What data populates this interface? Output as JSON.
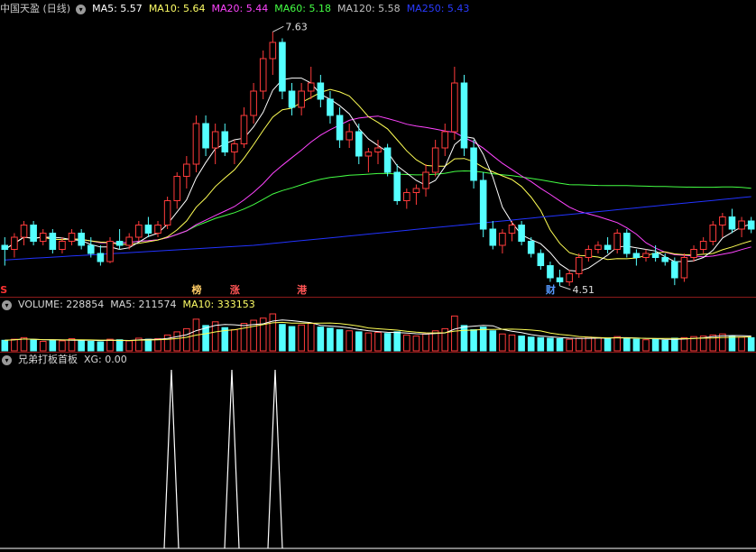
{
  "main": {
    "title": "中国天盈 (日线)",
    "ma_labels": [
      {
        "text": "MA5: 5.57",
        "color": "#ffffff"
      },
      {
        "text": "MA10: 5.64",
        "color": "#ffff66"
      },
      {
        "text": "MA20: 5.44",
        "color": "#ff44ff"
      },
      {
        "text": "MA60: 5.18",
        "color": "#44ff44"
      },
      {
        "text": "MA120: 5.58",
        "color": "#c0c0c0"
      },
      {
        "text": "MA250: 5.43",
        "color": "#2a3bff"
      }
    ],
    "high_label": "7.63",
    "low_label": "4.51",
    "markers": [
      {
        "text": "S",
        "color": "#ff3333"
      },
      {
        "text": "榜",
        "color": "#ffcc66"
      },
      {
        "text": "涨",
        "color": "#ff5555"
      },
      {
        "text": "港",
        "color": "#ff5555"
      },
      {
        "text": "财",
        "color": "#5599ff"
      }
    ]
  },
  "volume": {
    "labels": [
      {
        "text": "VOLUME: 228854",
        "color": "#d8d8d8"
      },
      {
        "text": "MA5: 211574",
        "color": "#d8d8d8"
      },
      {
        "text": "MA10: 333153",
        "color": "#ffff66"
      }
    ]
  },
  "indicator": {
    "labels": [
      {
        "text": "兄弟打板首板",
        "color": "#d8d8d8"
      },
      {
        "text": "XG: 0.00",
        "color": "#d8d8d8"
      }
    ],
    "signals": [
      0.7,
      2.2,
      4.8
    ]
  },
  "colors": {
    "up": "#ff3b3b",
    "down": "#54ffff",
    "ma5": "#ffffff",
    "ma10": "#ffff55",
    "ma20": "#ff44ff",
    "ma60": "#44ff44",
    "ma250": "#2233ff"
  },
  "chart_data": {
    "type": "candlestick",
    "candles": [
      [
        5.0,
        5.1,
        4.75,
        4.95
      ],
      [
        4.95,
        5.15,
        4.85,
        5.1
      ],
      [
        5.1,
        5.3,
        5.0,
        5.25
      ],
      [
        5.25,
        5.3,
        5.0,
        5.05
      ],
      [
        5.05,
        5.2,
        5.0,
        5.15
      ],
      [
        5.15,
        5.2,
        4.9,
        4.95
      ],
      [
        4.95,
        5.1,
        4.9,
        5.05
      ],
      [
        5.05,
        5.2,
        5.0,
        5.15
      ],
      [
        5.15,
        5.2,
        4.95,
        5.0
      ],
      [
        5.0,
        5.1,
        4.85,
        4.9
      ],
      [
        4.9,
        5.0,
        4.75,
        4.8
      ],
      [
        4.8,
        5.1,
        4.78,
        5.05
      ],
      [
        5.05,
        5.2,
        4.95,
        5.0
      ],
      [
        5.0,
        5.15,
        4.95,
        5.1
      ],
      [
        5.1,
        5.3,
        5.05,
        5.25
      ],
      [
        5.25,
        5.35,
        5.1,
        5.15
      ],
      [
        5.15,
        5.3,
        5.1,
        5.25
      ],
      [
        5.25,
        5.6,
        5.2,
        5.55
      ],
      [
        5.55,
        5.9,
        5.45,
        5.85
      ],
      [
        5.85,
        6.1,
        5.7,
        6.0
      ],
      [
        6.0,
        6.6,
        5.9,
        6.5
      ],
      [
        6.5,
        6.6,
        6.1,
        6.2
      ],
      [
        6.2,
        6.5,
        6.0,
        6.4
      ],
      [
        6.4,
        6.5,
        6.1,
        6.15
      ],
      [
        6.15,
        6.3,
        6.0,
        6.25
      ],
      [
        6.25,
        6.7,
        6.2,
        6.6
      ],
      [
        6.6,
        7.0,
        6.5,
        6.9
      ],
      [
        6.9,
        7.4,
        6.8,
        7.3
      ],
      [
        7.3,
        7.63,
        7.1,
        7.5
      ],
      [
        7.5,
        7.55,
        6.8,
        6.9
      ],
      [
        6.9,
        7.0,
        6.6,
        6.7
      ],
      [
        6.7,
        7.0,
        6.6,
        6.9
      ],
      [
        6.9,
        7.2,
        6.8,
        7.0
      ],
      [
        7.0,
        7.1,
        6.7,
        6.8
      ],
      [
        6.8,
        6.9,
        6.5,
        6.6
      ],
      [
        6.6,
        6.7,
        6.2,
        6.3
      ],
      [
        6.3,
        6.5,
        6.2,
        6.4
      ],
      [
        6.4,
        6.5,
        6.0,
        6.1
      ],
      [
        6.1,
        6.2,
        5.9,
        6.15
      ],
      [
        6.15,
        6.3,
        6.0,
        6.2
      ],
      [
        6.2,
        6.25,
        5.85,
        5.9
      ],
      [
        5.9,
        6.0,
        5.5,
        5.55
      ],
      [
        5.55,
        5.7,
        5.45,
        5.65
      ],
      [
        5.65,
        5.75,
        5.5,
        5.7
      ],
      [
        5.7,
        6.0,
        5.6,
        5.9
      ],
      [
        5.9,
        6.3,
        5.85,
        6.2
      ],
      [
        6.2,
        6.5,
        6.1,
        6.4
      ],
      [
        6.4,
        7.2,
        6.3,
        7.0
      ],
      [
        7.0,
        7.1,
        6.1,
        6.2
      ],
      [
        6.2,
        6.3,
        5.7,
        5.8
      ],
      [
        5.8,
        5.9,
        5.1,
        5.2
      ],
      [
        5.2,
        5.3,
        4.95,
        5.0
      ],
      [
        5.0,
        5.2,
        4.9,
        5.15
      ],
      [
        5.15,
        5.3,
        5.05,
        5.25
      ],
      [
        5.25,
        5.3,
        5.0,
        5.05
      ],
      [
        5.05,
        5.1,
        4.85,
        4.9
      ],
      [
        4.9,
        4.95,
        4.7,
        4.75
      ],
      [
        4.75,
        4.8,
        4.55,
        4.6
      ],
      [
        4.6,
        4.7,
        4.5,
        4.55
      ],
      [
        4.55,
        4.7,
        4.5,
        4.65
      ],
      [
        4.65,
        4.9,
        4.6,
        4.85
      ],
      [
        4.85,
        5.0,
        4.8,
        4.95
      ],
      [
        4.95,
        5.05,
        4.9,
        5.0
      ],
      [
        5.0,
        5.1,
        4.9,
        4.95
      ],
      [
        4.95,
        5.2,
        4.9,
        5.15
      ],
      [
        5.15,
        5.2,
        4.85,
        4.9
      ],
      [
        4.9,
        4.95,
        4.75,
        4.85
      ],
      [
        4.85,
        4.95,
        4.8,
        4.9
      ],
      [
        4.9,
        5.0,
        4.8,
        4.85
      ],
      [
        4.85,
        4.9,
        4.75,
        4.8
      ],
      [
        4.8,
        4.85,
        4.51,
        4.6
      ],
      [
        4.6,
        4.9,
        4.55,
        4.85
      ],
      [
        4.85,
        5.0,
        4.8,
        4.95
      ],
      [
        4.95,
        5.1,
        4.9,
        5.05
      ],
      [
        5.05,
        5.3,
        5.0,
        5.25
      ],
      [
        5.25,
        5.4,
        5.1,
        5.35
      ],
      [
        5.35,
        5.45,
        5.15,
        5.2
      ],
      [
        5.2,
        5.35,
        5.1,
        5.3
      ],
      [
        5.3,
        5.35,
        5.15,
        5.2
      ]
    ],
    "volume": [
      20,
      22,
      25,
      21,
      18,
      20,
      19,
      23,
      20,
      18,
      17,
      22,
      21,
      19,
      24,
      22,
      23,
      30,
      36,
      42,
      60,
      48,
      55,
      44,
      40,
      52,
      58,
      62,
      70,
      50,
      46,
      49,
      52,
      45,
      43,
      40,
      38,
      36,
      34,
      35,
      33,
      36,
      30,
      28,
      32,
      38,
      42,
      66,
      48,
      40,
      45,
      38,
      32,
      30,
      28,
      26,
      25,
      24,
      23,
      22,
      24,
      26,
      25,
      23,
      27,
      24,
      22,
      21,
      22,
      20,
      24,
      25,
      27,
      28,
      30,
      32,
      28,
      26,
      25
    ],
    "xg_signals": [
      0.7,
      2.2,
      4.8
    ],
    "ma250": [
      [
        0,
        4.82
      ],
      [
        0.5,
        5.0
      ],
      [
        1,
        5.3
      ],
      [
        1.5,
        5.6
      ]
    ],
    "ylim": [
      4.4,
      7.8
    ]
  }
}
